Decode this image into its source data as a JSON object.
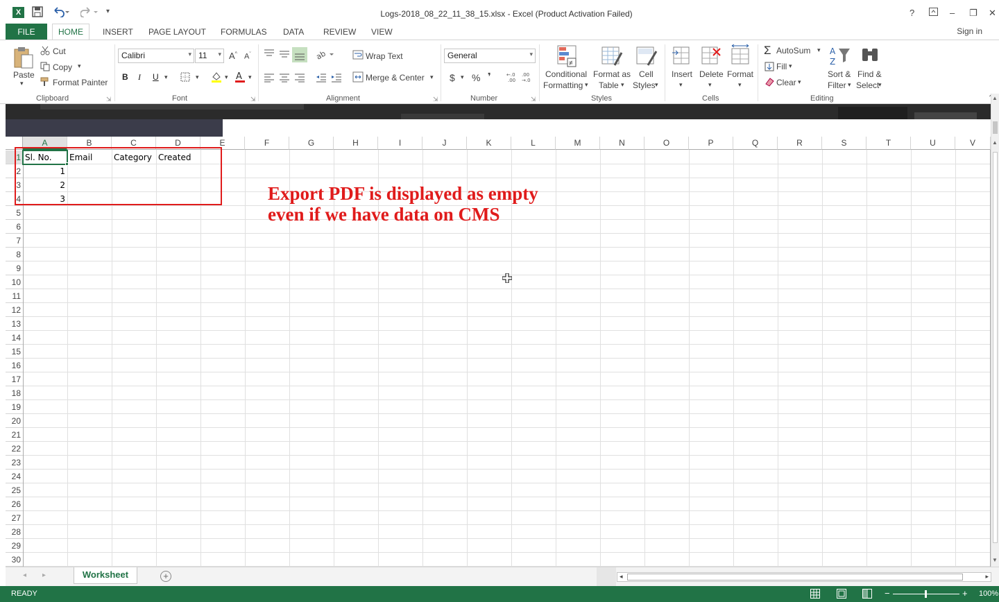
{
  "window": {
    "title": "Logs-2018_08_22_11_38_15.xlsx - Excel (Product Activation Failed)",
    "help": "?",
    "minimize": "–",
    "restore": "❐",
    "close": "✕"
  },
  "tabs": {
    "file": "FILE",
    "items": [
      "HOME",
      "INSERT",
      "PAGE LAYOUT",
      "FORMULAS",
      "DATA",
      "REVIEW",
      "VIEW"
    ],
    "signin": "Sign in"
  },
  "ribbon": {
    "clipboard": {
      "paste": "Paste",
      "cut": "Cut",
      "copy": "Copy",
      "format_painter": "Format Painter",
      "label": "Clipboard"
    },
    "font": {
      "name": "Calibri",
      "size": "11",
      "bold": "B",
      "italic": "I",
      "underline": "U",
      "label": "Font"
    },
    "alignment": {
      "wrap": "Wrap Text",
      "merge": "Merge & Center",
      "label": "Alignment"
    },
    "number": {
      "format": "General",
      "currency": "$",
      "percent": "%",
      "comma": "❜",
      "label": "Number"
    },
    "styles": {
      "conditional_1": "Conditional",
      "conditional_2": "Formatting",
      "format_table_1": "Format as",
      "format_table_2": "Table",
      "cell_styles_1": "Cell",
      "cell_styles_2": "Styles",
      "label": "Styles"
    },
    "cells": {
      "insert": "Insert",
      "delete": "Delete",
      "format": "Format",
      "label": "Cells"
    },
    "editing": {
      "autosum": "AutoSum",
      "fill": "Fill",
      "clear": "Clear",
      "sort_1": "Sort &",
      "sort_2": "Filter",
      "find_1": "Find &",
      "find_2": "Select",
      "label": "Editing"
    }
  },
  "grid": {
    "columns": [
      "A",
      "B",
      "C",
      "D",
      "E",
      "F",
      "G",
      "H",
      "I",
      "J",
      "K",
      "L",
      "M",
      "N",
      "O",
      "P",
      "Q",
      "R",
      "S",
      "T",
      "U",
      "V"
    ],
    "rows": [
      "1",
      "2",
      "3",
      "4",
      "5",
      "6",
      "7",
      "8",
      "9",
      "10",
      "11",
      "12",
      "13",
      "14",
      "15",
      "16",
      "17",
      "18",
      "19",
      "20",
      "21",
      "22",
      "23",
      "24",
      "25",
      "26",
      "27",
      "28",
      "29",
      "30"
    ],
    "headers": [
      "Sl. No.",
      "Email",
      "Category",
      "Created"
    ],
    "values": [
      "1",
      "2",
      "3"
    ]
  },
  "annotation": {
    "line1": "Export PDF is displayed as empty",
    "line2": "even if we have data on CMS"
  },
  "sheet": {
    "tab": "Worksheet",
    "add": "+"
  },
  "status": {
    "mode": "READY",
    "zoom": "100%"
  }
}
